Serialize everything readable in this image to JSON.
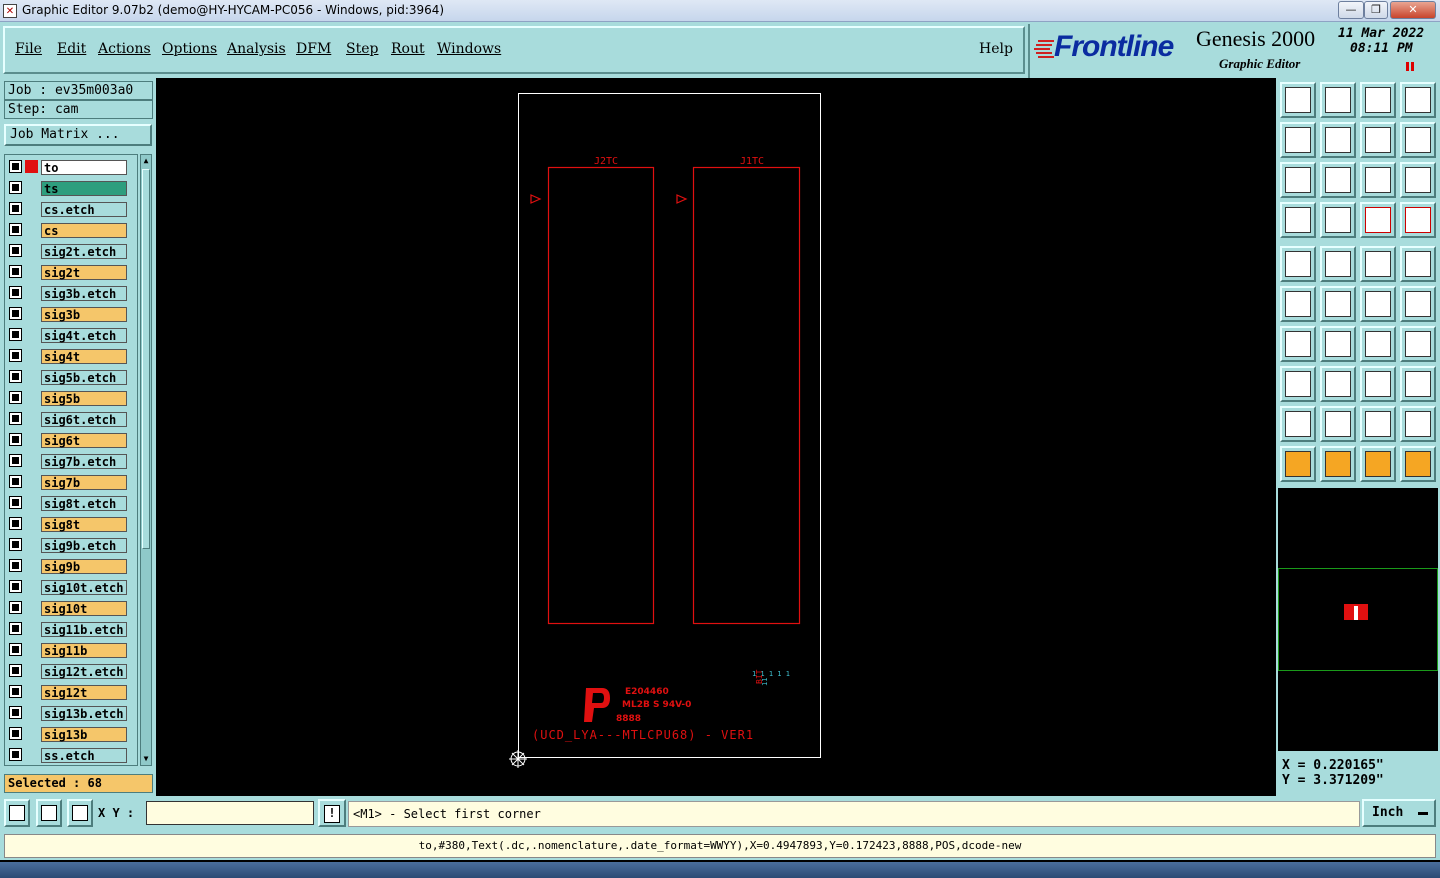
{
  "window": {
    "title": "Graphic Editor 9.07b2 (demo@HY-HYCAM-PC056 - Windows, pid:3964)",
    "minimize": "—",
    "maximize": "❐",
    "close": "✕"
  },
  "menu": {
    "items": [
      "File",
      "Edit",
      "Actions",
      "Options",
      "Analysis",
      "DFM",
      "Step",
      "Rout",
      "Windows"
    ],
    "help": "Help"
  },
  "brand": {
    "logo": "Frontline",
    "product": "Genesis 2000",
    "subtitle": "Graphic Editor",
    "date": "11 Mar 2022",
    "time": "08:11 PM"
  },
  "left_panel": {
    "job": "Job : ev35m003a0",
    "step": "Step: cam",
    "job_matrix": "Job Matrix ...",
    "layers": [
      {
        "name": "to",
        "color": "#ffffff"
      },
      {
        "name": "ts",
        "color": "#2e9e7e"
      },
      {
        "name": "cs.etch",
        "color": "#a8dcdc"
      },
      {
        "name": "cs",
        "color": "#f5c66a"
      },
      {
        "name": "sig2t.etch",
        "color": "#a8dcdc"
      },
      {
        "name": "sig2t",
        "color": "#f5c66a"
      },
      {
        "name": "sig3b.etch",
        "color": "#a8dcdc"
      },
      {
        "name": "sig3b",
        "color": "#f5c66a"
      },
      {
        "name": "sig4t.etch",
        "color": "#a8dcdc"
      },
      {
        "name": "sig4t",
        "color": "#f5c66a"
      },
      {
        "name": "sig5b.etch",
        "color": "#a8dcdc"
      },
      {
        "name": "sig5b",
        "color": "#f5c66a"
      },
      {
        "name": "sig6t.etch",
        "color": "#a8dcdc"
      },
      {
        "name": "sig6t",
        "color": "#f5c66a"
      },
      {
        "name": "sig7b.etch",
        "color": "#a8dcdc"
      },
      {
        "name": "sig7b",
        "color": "#f5c66a"
      },
      {
        "name": "sig8t.etch",
        "color": "#a8dcdc"
      },
      {
        "name": "sig8t",
        "color": "#f5c66a"
      },
      {
        "name": "sig9b.etch",
        "color": "#a8dcdc"
      },
      {
        "name": "sig9b",
        "color": "#f5c66a"
      },
      {
        "name": "sig10t.etch",
        "color": "#a8dcdc"
      },
      {
        "name": "sig10t",
        "color": "#f5c66a"
      },
      {
        "name": "sig11b.etch",
        "color": "#a8dcdc"
      },
      {
        "name": "sig11b",
        "color": "#f5c66a"
      },
      {
        "name": "sig12t.etch",
        "color": "#a8dcdc"
      },
      {
        "name": "sig12t",
        "color": "#f5c66a"
      },
      {
        "name": "sig13b.etch",
        "color": "#a8dcdc"
      },
      {
        "name": "sig13b",
        "color": "#f5c66a"
      },
      {
        "name": "ss.etch",
        "color": "#a8dcdc"
      }
    ],
    "selected": "Selected : 68"
  },
  "canvas": {
    "ref_left": "J2TC",
    "ref_right": "J1TC",
    "board_text": "(UCD_LYA---MTLCPU68) - VER1",
    "ul_code": "E204460",
    "ul_rating": "ML2B S 94V-0",
    "date_code": "8888",
    "side_label": "BIT",
    "trace_color": "#e01010",
    "outline_color": "#ffffff",
    "text_color": "#3fc0d0"
  },
  "right_panel": {
    "x": "X  =  0.220165\"",
    "y": "Y  =  3.371209\""
  },
  "bottom": {
    "xy_label": "X Y :",
    "xy_value": "",
    "prompt": "<M1> - Select first corner",
    "units": "Inch",
    "status": "to,#380,Text(.dc,.nomenclature,.date_format=WWYY),X=0.4947893,Y=0.172423,8888,POS,dcode-new"
  }
}
